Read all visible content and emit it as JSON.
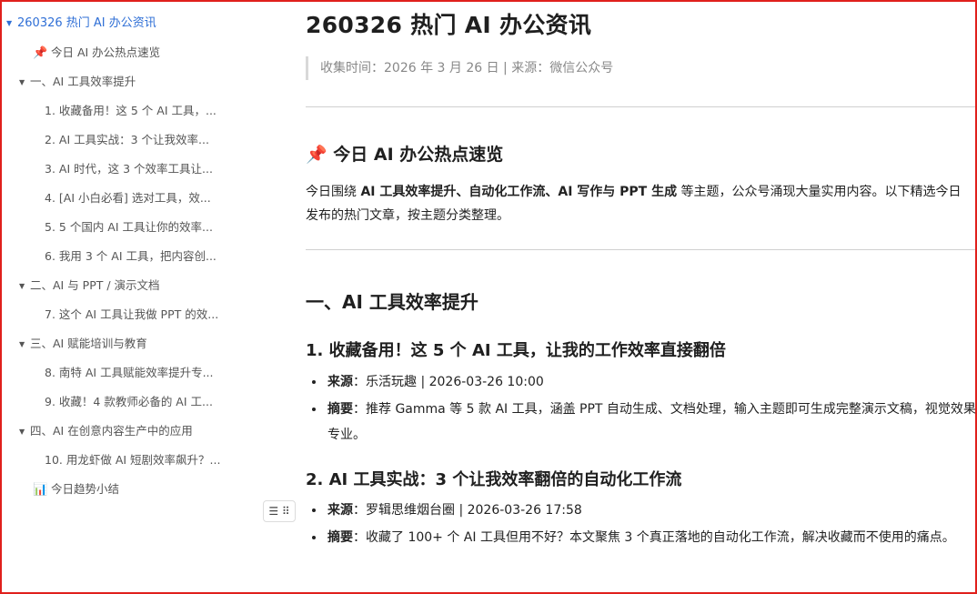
{
  "sidebar": {
    "root": "260326 热门 AI 办公资讯",
    "items": [
      "今日 AI 办公热点速览",
      "一、AI 工具效率提升",
      "1. 收藏备用！这 5 个 AI 工具，...",
      "2. AI 工具实战：3 个让我效率...",
      "3. AI 时代，这 3 个效率工具让...",
      "4. [AI 小白必看] 选对工具，效...",
      "5. 5 个国内 AI 工具让你的效率...",
      "6. 我用 3 个 AI 工具，把内容创...",
      "二、AI 与 PPT / 演示文档",
      "7. 这个 AI 工具让我做 PPT 的效...",
      "三、AI 赋能培训与教育",
      "8. 南特 AI 工具赋能效率提升专...",
      "9. 收藏！4 款教师必备的 AI 工...",
      "四、AI 在创意内容生产中的应用",
      "10. 用龙虾做 AI 短剧效率飙升？...",
      "今日趋势小结"
    ],
    "icons": {
      "pin": "📌",
      "chart": "📊",
      "toc_button": "☰ ⠿"
    }
  },
  "doc": {
    "title": "260326 热门 AI 办公资讯",
    "meta_line": "收集时间：2026 年 3 月 26 日 | 来源：微信公众号",
    "hot_heading": "今日 AI 办公热点速览",
    "hot_icon": "📌",
    "intro_a": "今日围绕 ",
    "intro_bold": "AI 工具效率提升、自动化工作流、AI 写作与 PPT 生成",
    "intro_b": " 等主题，公众号涌现大量实用内容。以下精选今日发布的热门文章，按主题分类整理。",
    "section1": "一、AI 工具效率提升",
    "articles": [
      {
        "title": "1. 收藏备用！这 5 个 AI 工具，让我的工作效率直接翻倍",
        "source_label": "来源",
        "source": "：乐活玩趣 | 2026-03-26 10:00",
        "summary_label": "摘要",
        "summary": "：推荐 Gamma 等 5 款 AI 工具，涵盖 PPT 自动生成、文档处理，输入主题即可生成完整演示文稿，视觉效果专业。"
      },
      {
        "title": "2. AI 工具实战：3 个让我效率翻倍的自动化工作流",
        "source_label": "来源",
        "source": "：罗辑思维烟台圈 | 2026-03-26 17:58",
        "summary_label": "摘要",
        "summary": "：收藏了 100+ 个 AI 工具但用不好？本文聚焦 3 个真正落地的自动化工作流，解决收藏而不使用的痛点。"
      }
    ]
  }
}
